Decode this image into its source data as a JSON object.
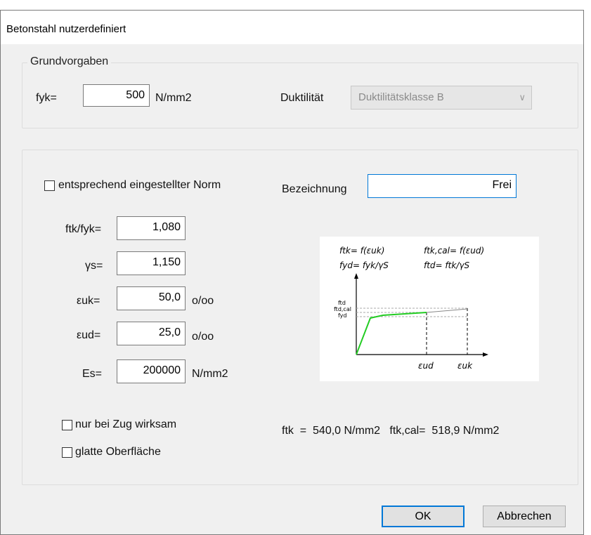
{
  "window": {
    "title": "Betonstahl nutzerdefiniert"
  },
  "grundvorgaben": {
    "legend": "Grundvorgaben",
    "fyk_label": "fyk=",
    "fyk_value": "500",
    "fyk_unit": "N/mm2",
    "duktilitaet_label": "Duktilität",
    "duktilitaet_value": "Duktilitätsklasse B"
  },
  "main": {
    "norm_checkbox_label": "entsprechend eingestellter Norm",
    "norm_checked": false,
    "bezeichnung_label": "Bezeichnung",
    "bezeichnung_value": "Frei",
    "fields": [
      {
        "label": "ftk/fyk=",
        "value": "1,080",
        "unit": ""
      },
      {
        "label": "γs=",
        "value": "1,150",
        "unit": ""
      },
      {
        "label": "εuk=",
        "value": "50,0",
        "unit": "o/oo"
      },
      {
        "label": "εud=",
        "value": "25,0",
        "unit": "o/oo"
      },
      {
        "label": "Es=",
        "value": "200000",
        "unit": "N/mm2"
      }
    ],
    "zug_label": "nur bei Zug wirksam",
    "zug_checked": false,
    "glatt_label": "glatte Oberfläche",
    "glatt_checked": false,
    "result_text": "ftk  =  540,0 N/mm2   ftk,cal=  518,9 N/mm2"
  },
  "diagram": {
    "formula1": "ftk= f(εuk)",
    "formula2": "ftk,cal= f(εud)",
    "formula3": "fyd= fyk/γS",
    "formula4": "ftd= ftk/γS",
    "ylabel_ftd": "ftd",
    "ylabel_ftdcal": "ftd,cal",
    "ylabel_fyd": "fyd",
    "xlabel_eud": "εud",
    "xlabel_euk": "εuk"
  },
  "buttons": {
    "ok": "OK",
    "cancel": "Abbrechen"
  }
}
